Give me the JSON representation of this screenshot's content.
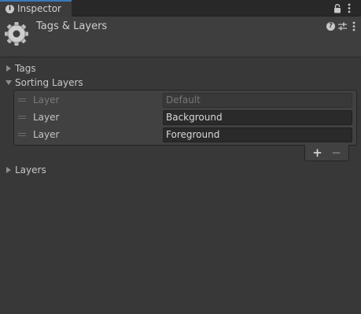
{
  "tab": {
    "label": "Inspector",
    "info_glyph": "i"
  },
  "header": {
    "title": "Tags & Layers",
    "help_glyph": "?"
  },
  "sections": {
    "tags": {
      "label": "Tags",
      "expanded": false
    },
    "sorting_layers": {
      "label": "Sorting Layers",
      "expanded": true,
      "rows": [
        {
          "label": "Layer",
          "value": "Default",
          "editable": false
        },
        {
          "label": "Layer",
          "value": "Background",
          "editable": true
        },
        {
          "label": "Layer",
          "value": "Foreground",
          "editable": true
        }
      ],
      "add_label": "+",
      "remove_label": "−"
    },
    "layers": {
      "label": "Layers",
      "expanded": false
    }
  },
  "icons": {
    "tab_info": "info-icon",
    "lock": "lock-icon",
    "tab_menu": "kebab-menu-icon",
    "component": "gear-icon",
    "help": "help-icon",
    "presets": "presets-sliders-icon",
    "header_menu": "kebab-menu-icon",
    "collapsed": "triangle-right-icon",
    "expanded": "triangle-down-icon",
    "drag": "drag-handle-icon"
  },
  "colors": {
    "background": "#383838",
    "tab_accent": "#3a79bb",
    "field": "#2a2a2a",
    "text": "#c4c4c4"
  }
}
